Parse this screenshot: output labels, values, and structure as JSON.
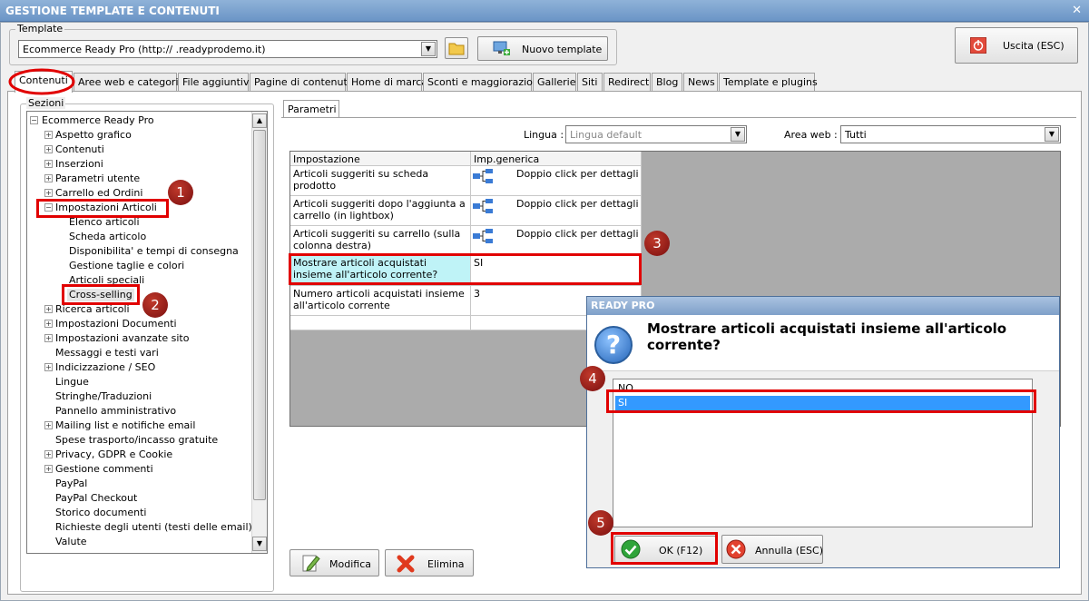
{
  "window": {
    "title": "GESTIONE TEMPLATE E CONTENUTI",
    "close_glyph": "✕"
  },
  "template": {
    "group_label": "Template",
    "selected": "Ecommerce Ready Pro (http://      .readyprodemo.it)",
    "new_button": "Nuovo template",
    "exit_button": "Uscita (ESC)"
  },
  "tabs": [
    "Contenuti",
    "Aree web e categorie",
    "File aggiuntivi",
    "Pagine di contenuti",
    "Home di marca",
    "Sconti e maggiorazioni",
    "Gallerie",
    "Siti",
    "Redirect",
    "Blog",
    "News",
    "Template e plugins"
  ],
  "sections": {
    "group_label": "Sezioni",
    "root": "Ecommerce Ready Pro",
    "items": [
      "Aspetto grafico",
      "Contenuti",
      "Inserzioni",
      "Parametri utente",
      "Carrello ed Ordini",
      "Impostazioni Articoli",
      "Elenco articoli",
      "Scheda articolo",
      "Disponibilita' e tempi di consegna",
      "Gestione taglie e colori",
      "Articoli speciali",
      "Cross-selling",
      "Ricerca articoli",
      "Impostazioni Documenti",
      "Impostazioni avanzate sito",
      "Messaggi e testi vari",
      "Indicizzazione / SEO",
      "Lingue",
      "Stringhe/Traduzioni",
      "Pannello amministrativo",
      "Mailing list e notifiche email",
      "Spese trasporto/incasso gratuite",
      "Privacy, GDPR e Cookie",
      "Gestione commenti",
      "PayPal",
      "PayPal Checkout",
      "Storico documenti",
      "Richieste degli utenti (testi delle email)",
      "Valute"
    ]
  },
  "params": {
    "tab_label": "Parametri",
    "lingua_label": "Lingua :",
    "lingua_value": "Lingua default",
    "area_label": "Area web :",
    "area_value": "Tutti",
    "col_setting": "Impostazione",
    "col_value": "Imp.generica",
    "rows": [
      {
        "setting": "Articoli suggeriti su scheda prodotto",
        "value": "Doppio click per dettagli"
      },
      {
        "setting": "Articoli suggeriti dopo l'aggiunta a carrello (in lightbox)",
        "value": "Doppio click per dettagli"
      },
      {
        "setting": "Articoli suggeriti su carrello (sulla colonna destra)",
        "value": "Doppio click per dettagli"
      },
      {
        "setting": "Mostrare articoli acquistati insieme all'articolo corrente?",
        "value": "SI"
      },
      {
        "setting": "Numero articoli acquistati insieme all'articolo corrente",
        "value": "3"
      }
    ],
    "modify_button": "Modifica",
    "delete_button": "Elimina"
  },
  "dialog": {
    "title": "READY PRO",
    "question": "Mostrare articoli acquistati insieme all'articolo corrente?",
    "options": [
      "NO",
      "SI"
    ],
    "selected": "SI",
    "ok_button": "OK (F12)",
    "cancel_button": "Annulla (ESC)"
  },
  "annotations": [
    "1",
    "2",
    "3",
    "4",
    "5"
  ],
  "colors": {
    "highlight_red": "#e10000",
    "selection_blue": "#3399ff",
    "selected_cell": "#bff3f7"
  }
}
